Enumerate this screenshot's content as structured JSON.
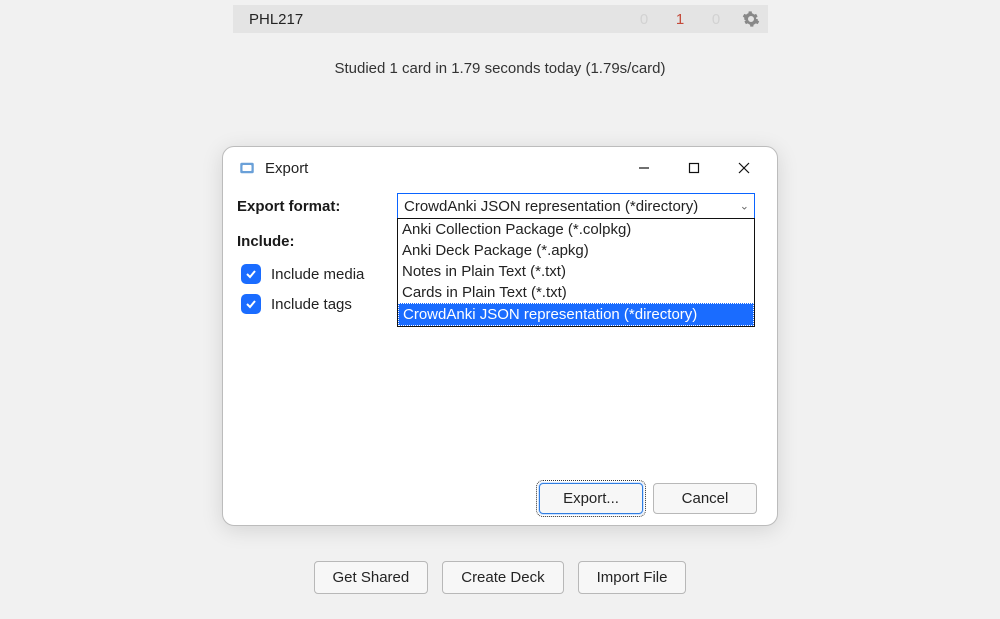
{
  "deck": {
    "name": "PHL217",
    "new": "0",
    "due": "1",
    "learn": "0"
  },
  "stats_line": "Studied 1 card in 1.79 seconds today (1.79s/card)",
  "bottom": {
    "get_shared": "Get Shared",
    "create_deck": "Create Deck",
    "import_file": "Import File"
  },
  "modal": {
    "title": "Export",
    "label_format": "Export format:",
    "label_include": "Include:",
    "selected": "CrowdAnki JSON representation (*directory)",
    "options": {
      "colpkg": "Anki Collection Package (*.colpkg)",
      "apkg": "Anki Deck Package (*.apkg)",
      "notes": "Notes in Plain Text (*.txt)",
      "cards": "Cards in Plain Text (*.txt)",
      "crowdanki": "CrowdAnki JSON representation (*directory)"
    },
    "include_media": "Include media",
    "include_tags": "Include tags",
    "export_btn": "Export...",
    "cancel_btn": "Cancel"
  }
}
